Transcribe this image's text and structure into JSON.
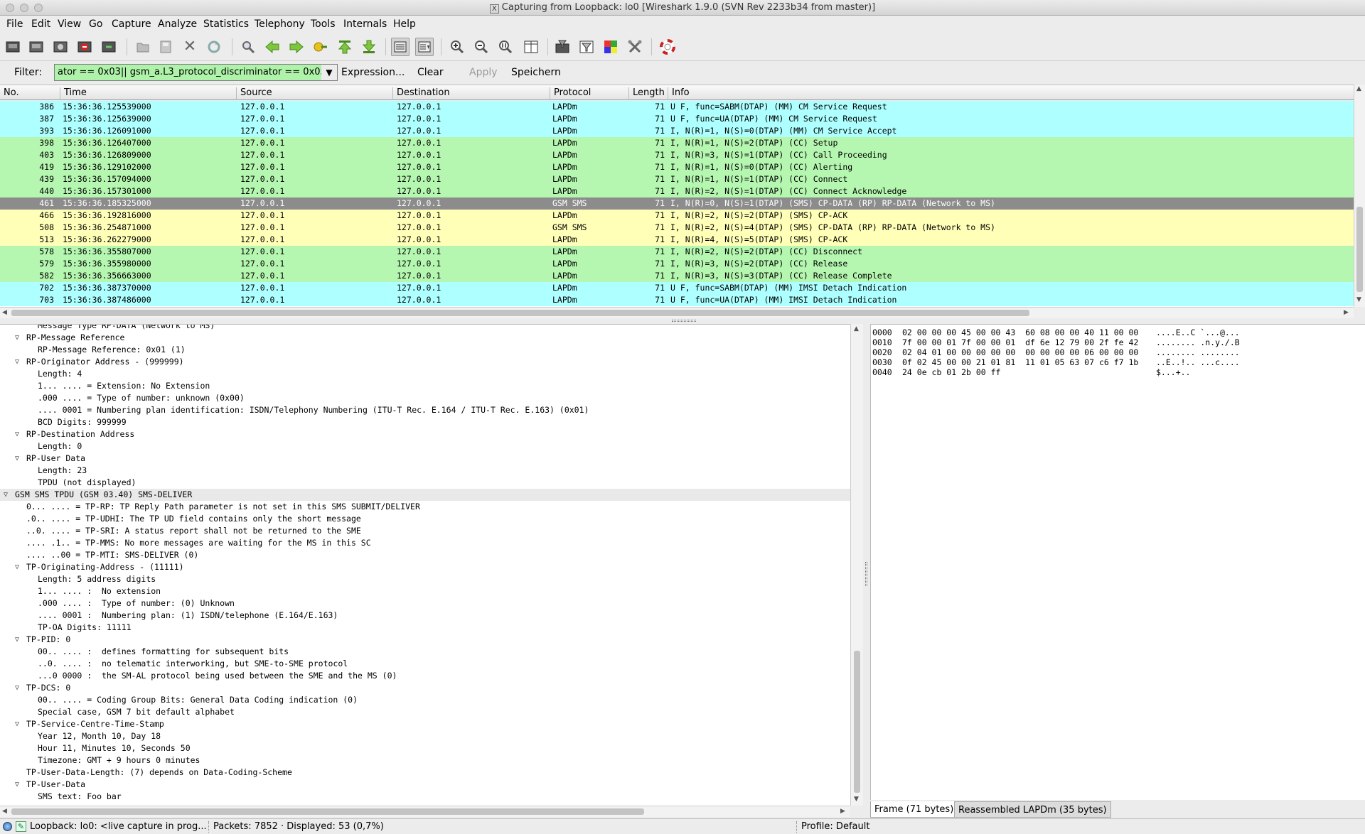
{
  "window": {
    "title": "Capturing from Loopback: lo0    [Wireshark 1.9.0  (SVN Rev 2233b34 from master)]"
  },
  "menu": [
    "File",
    "Edit",
    "View",
    "Go",
    "Capture",
    "Analyze",
    "Statistics",
    "Telephony",
    "Tools",
    "Internals",
    "Help"
  ],
  "toolbar": {
    "icons": [
      "interface-list-icon",
      "capture-options-icon",
      "start-capture-icon",
      "stop-capture-icon",
      "restart-capture-icon",
      "open-file-icon",
      "save-file-icon",
      "close-file-icon",
      "reload-icon",
      "find-packet-icon",
      "go-back-icon",
      "go-forward-icon",
      "go-to-packet-icon",
      "go-first-packet-icon",
      "go-last-packet-icon",
      "colorize-icon",
      "autoscroll-icon",
      "zoom-in-icon",
      "zoom-out-icon",
      "normal-size-icon",
      "resize-columns-icon",
      "capture-filters-icon",
      "display-filters-icon",
      "coloring-rules-icon",
      "preferences-icon",
      "help-icon"
    ]
  },
  "filter": {
    "label": "Filter:",
    "value": "ator == 0x03|| gsm_a.L3_protocol_discriminator == 0x05",
    "expression_label": "Expression...",
    "clear_label": "Clear",
    "apply_label": "Apply",
    "save_label": "Speichern"
  },
  "packet_list": {
    "columns": [
      "No.",
      "Time",
      "Source",
      "Destination",
      "Protocol",
      "Length",
      "Info"
    ],
    "rows": [
      {
        "no": "386",
        "time": "15:36:36.125539000",
        "src": "127.0.0.1",
        "dst": "127.0.0.1",
        "proto": "LAPDm",
        "len": "71",
        "info": "U F, func=SABM(DTAP) (MM) CM Service Request",
        "bg": "#aeffff",
        "fg": "#000000"
      },
      {
        "no": "387",
        "time": "15:36:36.125639000",
        "src": "127.0.0.1",
        "dst": "127.0.0.1",
        "proto": "LAPDm",
        "len": "71",
        "info": "U F, func=UA(DTAP) (MM) CM Service Request",
        "bg": "#aeffff",
        "fg": "#000000"
      },
      {
        "no": "393",
        "time": "15:36:36.126091000",
        "src": "127.0.0.1",
        "dst": "127.0.0.1",
        "proto": "LAPDm",
        "len": "71",
        "info": "I, N(R)=1, N(S)=0(DTAP) (MM) CM Service Accept",
        "bg": "#aeffff",
        "fg": "#000000"
      },
      {
        "no": "398",
        "time": "15:36:36.126407000",
        "src": "127.0.0.1",
        "dst": "127.0.0.1",
        "proto": "LAPDm",
        "len": "71",
        "info": "I, N(R)=1, N(S)=2(DTAP) (CC) Setup",
        "bg": "#b5f7b0",
        "fg": "#000000"
      },
      {
        "no": "403",
        "time": "15:36:36.126809000",
        "src": "127.0.0.1",
        "dst": "127.0.0.1",
        "proto": "LAPDm",
        "len": "71",
        "info": "I, N(R)=3, N(S)=1(DTAP) (CC) Call Proceeding",
        "bg": "#b5f7b0",
        "fg": "#000000"
      },
      {
        "no": "419",
        "time": "15:36:36.129102000",
        "src": "127.0.0.1",
        "dst": "127.0.0.1",
        "proto": "LAPDm",
        "len": "71",
        "info": "I, N(R)=1, N(S)=0(DTAP) (CC) Alerting",
        "bg": "#b5f7b0",
        "fg": "#000000"
      },
      {
        "no": "439",
        "time": "15:36:36.157094000",
        "src": "127.0.0.1",
        "dst": "127.0.0.1",
        "proto": "LAPDm",
        "len": "71",
        "info": "I, N(R)=1, N(S)=1(DTAP) (CC) Connect",
        "bg": "#b5f7b0",
        "fg": "#000000"
      },
      {
        "no": "440",
        "time": "15:36:36.157301000",
        "src": "127.0.0.1",
        "dst": "127.0.0.1",
        "proto": "LAPDm",
        "len": "71",
        "info": "I, N(R)=2, N(S)=1(DTAP) (CC) Connect Acknowledge",
        "bg": "#b5f7b0",
        "fg": "#000000"
      },
      {
        "no": "461",
        "time": "15:36:36.185325000",
        "src": "127.0.0.1",
        "dst": "127.0.0.1",
        "proto": "GSM SMS",
        "len": "71",
        "info": "I, N(R)=0, N(S)=1(DTAP) (SMS) CP-DATA (RP) RP-DATA (Network to MS)",
        "bg": "#8c8c8c",
        "fg": "#ffffff"
      },
      {
        "no": "466",
        "time": "15:36:36.192816000",
        "src": "127.0.0.1",
        "dst": "127.0.0.1",
        "proto": "LAPDm",
        "len": "71",
        "info": "I, N(R)=2, N(S)=2(DTAP) (SMS) CP-ACK",
        "bg": "#ffffb8",
        "fg": "#000000"
      },
      {
        "no": "508",
        "time": "15:36:36.254871000",
        "src": "127.0.0.1",
        "dst": "127.0.0.1",
        "proto": "GSM SMS",
        "len": "71",
        "info": "I, N(R)=2, N(S)=4(DTAP) (SMS) CP-DATA (RP) RP-DATA (Network to MS)",
        "bg": "#ffffb8",
        "fg": "#000000"
      },
      {
        "no": "513",
        "time": "15:36:36.262279000",
        "src": "127.0.0.1",
        "dst": "127.0.0.1",
        "proto": "LAPDm",
        "len": "71",
        "info": "I, N(R)=4, N(S)=5(DTAP) (SMS) CP-ACK",
        "bg": "#ffffb8",
        "fg": "#000000"
      },
      {
        "no": "578",
        "time": "15:36:36.355807000",
        "src": "127.0.0.1",
        "dst": "127.0.0.1",
        "proto": "LAPDm",
        "len": "71",
        "info": "I, N(R)=2, N(S)=2(DTAP) (CC) Disconnect",
        "bg": "#b5f7b0",
        "fg": "#000000"
      },
      {
        "no": "579",
        "time": "15:36:36.355980000",
        "src": "127.0.0.1",
        "dst": "127.0.0.1",
        "proto": "LAPDm",
        "len": "71",
        "info": "I, N(R)=3, N(S)=2(DTAP) (CC) Release",
        "bg": "#b5f7b0",
        "fg": "#000000"
      },
      {
        "no": "582",
        "time": "15:36:36.356663000",
        "src": "127.0.0.1",
        "dst": "127.0.0.1",
        "proto": "LAPDm",
        "len": "71",
        "info": "I, N(R)=3, N(S)=3(DTAP) (CC) Release Complete",
        "bg": "#b5f7b0",
        "fg": "#000000"
      },
      {
        "no": "702",
        "time": "15:36:36.387370000",
        "src": "127.0.0.1",
        "dst": "127.0.0.1",
        "proto": "LAPDm",
        "len": "71",
        "info": "U F, func=SABM(DTAP) (MM) IMSI Detach Indication",
        "bg": "#aeffff",
        "fg": "#000000"
      },
      {
        "no": "703",
        "time": "15:36:36.387486000",
        "src": "127.0.0.1",
        "dst": "127.0.0.1",
        "proto": "LAPDm",
        "len": "71",
        "info": "U F, func=UA(DTAP) (MM) IMSI Detach Indication",
        "bg": "#aeffff",
        "fg": "#000000"
      }
    ]
  },
  "details": [
    {
      "indent": 2,
      "tri": "",
      "text": "Message Type RP-DATA (Network to MS)"
    },
    {
      "indent": 1,
      "tri": "open",
      "text": "RP-Message Reference"
    },
    {
      "indent": 2,
      "tri": "",
      "text": "RP-Message Reference: 0x01 (1)"
    },
    {
      "indent": 1,
      "tri": "open",
      "text": "RP-Originator Address - (999999)"
    },
    {
      "indent": 2,
      "tri": "",
      "text": "Length: 4"
    },
    {
      "indent": 2,
      "tri": "",
      "text": "1... .... = Extension: No Extension"
    },
    {
      "indent": 2,
      "tri": "",
      "text": ".000 .... = Type of number: unknown (0x00)"
    },
    {
      "indent": 2,
      "tri": "",
      "text": ".... 0001 = Numbering plan identification: ISDN/Telephony Numbering (ITU-T Rec. E.164 / ITU-T Rec. E.163) (0x01)"
    },
    {
      "indent": 2,
      "tri": "",
      "text": "BCD Digits: 999999"
    },
    {
      "indent": 1,
      "tri": "open",
      "text": "RP-Destination Address"
    },
    {
      "indent": 2,
      "tri": "",
      "text": "Length: 0"
    },
    {
      "indent": 1,
      "tri": "open",
      "text": "RP-User Data"
    },
    {
      "indent": 2,
      "tri": "",
      "text": "Length: 23"
    },
    {
      "indent": 2,
      "tri": "",
      "text": "TPDU (not displayed)"
    },
    {
      "indent": 0,
      "tri": "open",
      "text": "GSM SMS TPDU (GSM 03.40) SMS-DELIVER",
      "hl": true
    },
    {
      "indent": 1,
      "tri": "",
      "text": "0... .... = TP-RP: TP Reply Path parameter is not set in this SMS SUBMIT/DELIVER"
    },
    {
      "indent": 1,
      "tri": "",
      "text": ".0.. .... = TP-UDHI: The TP UD field contains only the short message"
    },
    {
      "indent": 1,
      "tri": "",
      "text": "..0. .... = TP-SRI: A status report shall not be returned to the SME"
    },
    {
      "indent": 1,
      "tri": "",
      "text": ".... .1.. = TP-MMS: No more messages are waiting for the MS in this SC"
    },
    {
      "indent": 1,
      "tri": "",
      "text": ".... ..00 = TP-MTI: SMS-DELIVER (0)"
    },
    {
      "indent": 1,
      "tri": "open",
      "text": "TP-Originating-Address - (11111)"
    },
    {
      "indent": 2,
      "tri": "",
      "text": "Length: 5 address digits"
    },
    {
      "indent": 2,
      "tri": "",
      "text": "1... .... :  No extension"
    },
    {
      "indent": 2,
      "tri": "",
      "text": ".000 .... :  Type of number: (0) Unknown"
    },
    {
      "indent": 2,
      "tri": "",
      "text": ".... 0001 :  Numbering plan: (1) ISDN/telephone (E.164/E.163)"
    },
    {
      "indent": 2,
      "tri": "",
      "text": "TP-OA Digits: 11111"
    },
    {
      "indent": 1,
      "tri": "open",
      "text": "TP-PID: 0"
    },
    {
      "indent": 2,
      "tri": "",
      "text": "00.. .... :  defines formatting for subsequent bits"
    },
    {
      "indent": 2,
      "tri": "",
      "text": "..0. .... :  no telematic interworking, but SME-to-SME protocol"
    },
    {
      "indent": 2,
      "tri": "",
      "text": "...0 0000 :  the SM-AL protocol being used between the SME and the MS (0)"
    },
    {
      "indent": 1,
      "tri": "open",
      "text": "TP-DCS: 0"
    },
    {
      "indent": 2,
      "tri": "",
      "text": "00.. .... = Coding Group Bits: General Data Coding indication (0)"
    },
    {
      "indent": 2,
      "tri": "",
      "text": "Special case, GSM 7 bit default alphabet"
    },
    {
      "indent": 1,
      "tri": "open",
      "text": "TP-Service-Centre-Time-Stamp"
    },
    {
      "indent": 2,
      "tri": "",
      "text": "Year 12, Month 10, Day 18"
    },
    {
      "indent": 2,
      "tri": "",
      "text": "Hour 11, Minutes 10, Seconds 50"
    },
    {
      "indent": 2,
      "tri": "",
      "text": "Timezone: GMT + 9 hours 0 minutes"
    },
    {
      "indent": 1,
      "tri": "",
      "text": "TP-User-Data-Length: (7) depends on Data-Coding-Scheme"
    },
    {
      "indent": 1,
      "tri": "open",
      "text": "TP-User-Data"
    },
    {
      "indent": 2,
      "tri": "",
      "text": "SMS text: Foo bar"
    }
  ],
  "bytes": [
    {
      "off": "0000",
      "hex": "02 00 00 00 45 00 00 43  60 08 00 00 40 11 00 00",
      "ascii": "....E..C `...@..."
    },
    {
      "off": "0010",
      "hex": "7f 00 00 01 7f 00 00 01  df 6e 12 79 00 2f fe 42",
      "ascii": "........ .n.y./.B"
    },
    {
      "off": "0020",
      "hex": "02 04 01 00 00 00 00 00  00 00 00 00 06 00 00 00",
      "ascii": "........ ........"
    },
    {
      "off": "0030",
      "hex": "0f 02 45 00 00 21 01 81  11 01 05 63 07 c6 f7 1b",
      "ascii": "..E..!.. ...c...."
    },
    {
      "off": "0040",
      "hex": "24 0e cb 01 2b 00 ff",
      "ascii": "$...+.."
    }
  ],
  "byte_tabs": [
    "Frame (71 bytes)",
    "Reassembled LAPDm (35 bytes)"
  ],
  "status": {
    "capture": "Loopback: lo0: <live capture in prog...",
    "packets": "Packets: 7852 · Displayed: 53 (0,7%)",
    "profile": "Profile: Default"
  }
}
